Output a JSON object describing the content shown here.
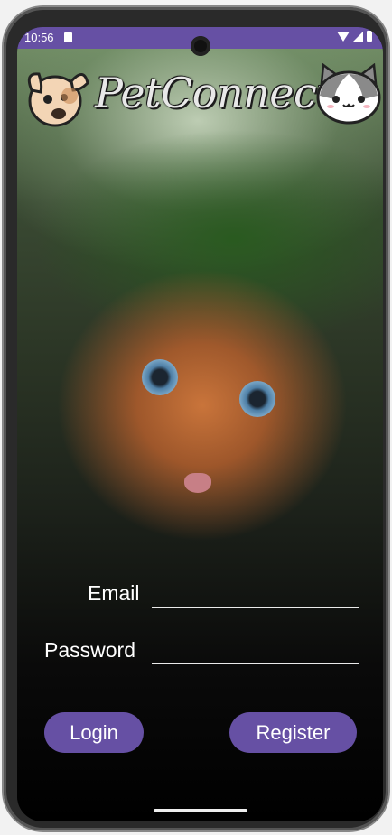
{
  "status_bar": {
    "time": "10:56",
    "sim_icon": "sim-card-icon",
    "wifi_icon": "wifi-icon",
    "signal_icon": "cell-signal-icon",
    "battery_icon": "battery-icon"
  },
  "header": {
    "app_name": "PetConnect",
    "left_mascot": "dog-mascot-icon",
    "right_mascot": "cat-mascot-icon"
  },
  "login_form": {
    "email_label": "Email",
    "email_value": "",
    "password_label": "Password",
    "password_value": ""
  },
  "actions": {
    "login_label": "Login",
    "register_label": "Register"
  },
  "colors": {
    "accent": "#6650a4",
    "text": "#ffffff",
    "input_underline": "#eaeaea"
  }
}
